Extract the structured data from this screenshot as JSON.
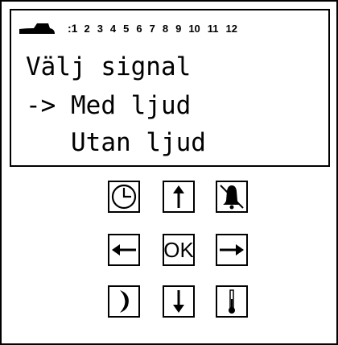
{
  "status_bar": {
    "logo_icon": "train-icon",
    "prefix": ":1",
    "numbers": [
      "2",
      "3",
      "4",
      "5",
      "6",
      "7",
      "8",
      "9",
      "10",
      "11",
      "12"
    ]
  },
  "display": {
    "title": "Välj signal",
    "selected_option": "-> Med ljud",
    "other_option": "Utan ljud"
  },
  "keypad": {
    "ok_label": "OK",
    "icons": [
      "clock-icon",
      "arrow-up-icon",
      "bell-off-icon",
      "arrow-left-icon",
      "arrow-right-icon",
      "moon-icon",
      "arrow-down-icon",
      "thermometer-icon"
    ]
  }
}
